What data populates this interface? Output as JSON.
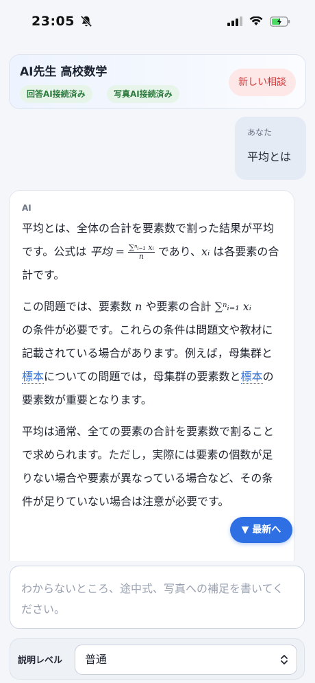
{
  "status": {
    "time": "23:05"
  },
  "header": {
    "title": "AI先生 高校数学",
    "badges": [
      "回答AI接続済み",
      "写真AI接続済み"
    ],
    "new_chat": "新しい相談"
  },
  "user_message": {
    "label": "あなた",
    "text": "平均とは"
  },
  "ai_message": {
    "label": "AI",
    "p1_a": "平均とは、全体の合計を要素数で割った結果が平均です。公式は",
    "p1_formula_lhs": "平均 =",
    "p1_frac_num": "∑ⁿᵢ₌₁ xᵢ",
    "p1_frac_den": "n",
    "p1_b": "であり、",
    "p1_var": "xᵢ",
    "p1_c": "は各要素の合計です。",
    "p2_a": "この問題では、要素数",
    "p2_n": "n",
    "p2_b": "や要素の合計",
    "p2_sum": "∑ⁿᵢ₌₁ xᵢ",
    "p2_c": "の条件が必要です。これらの条件は問題文や教材に記載されている場合があります。例えば，母集群と",
    "p2_link1": "標本",
    "p2_d": "についての問題では，母集群の要素数と",
    "p2_link2": "標本",
    "p2_e": "の要素数が重要となります。",
    "p3": "平均は通常、全ての要素の合計を要素数で割ることで求められます。ただし，実際には要素の個数が足りない場合や要素が異なっている場合など、その条件が足りていない場合は注意が必要です。"
  },
  "latest_button": "▼ 最新へ",
  "input": {
    "placeholder": "わからないところ、途中式、写真への補足を書いてください。"
  },
  "level": {
    "label": "説明レベル",
    "value": "普通"
  }
}
